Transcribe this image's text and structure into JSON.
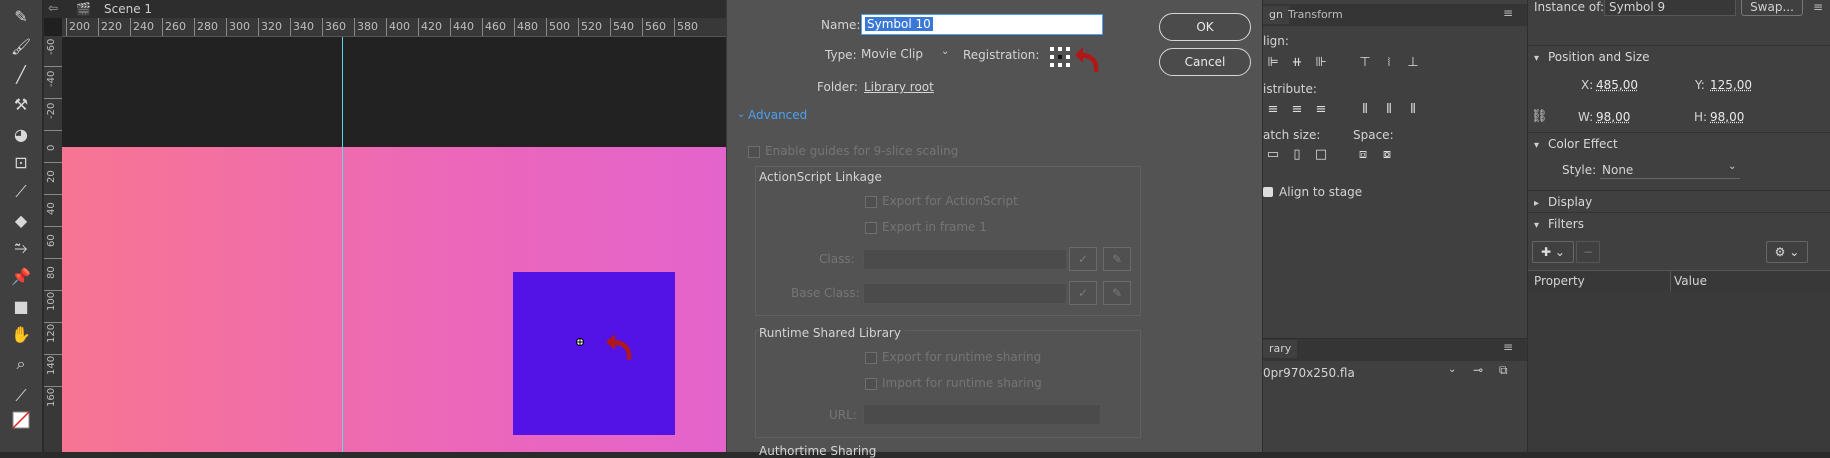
{
  "scene": {
    "label": "Scene 1"
  },
  "ruler": {
    "h_ticks": [
      "200",
      "220",
      "240",
      "260",
      "280",
      "300",
      "320",
      "340",
      "360",
      "380",
      "400",
      "420",
      "440",
      "460",
      "480",
      "500",
      "520",
      "540",
      "560",
      "580"
    ],
    "v_ticks": [
      "-60",
      "-40",
      "-20",
      "0",
      "20",
      "40",
      "60",
      "80",
      "100",
      "120",
      "140",
      "160"
    ]
  },
  "tools": [
    "pencil-icon",
    "paintbrush-icon",
    "brush-icon",
    "bone-icon",
    "paint-bucket-icon",
    "asset-warp-icon",
    "eyedropper-icon",
    "eraser-icon",
    "width-tool-icon",
    "pin-icon",
    "camera-icon",
    "hand-icon",
    "zoom-icon",
    "eyedropper-small-icon",
    "stroke-fill-icon"
  ],
  "dialog": {
    "name_label": "Name:",
    "name_value": "Symbol 10",
    "type_label": "Type:",
    "type_value": "Movie Clip",
    "registration_label": "Registration:",
    "folder_label": "Folder:",
    "folder_value": "Library root",
    "ok": "OK",
    "cancel": "Cancel",
    "advanced": "Advanced",
    "enable_guides": "Enable guides for 9-slice scaling",
    "as_linkage_title": "ActionScript Linkage",
    "export_as": "Export for ActionScript",
    "export_frame1": "Export in frame 1",
    "class_label": "Class:",
    "base_class_label": "Base Class:",
    "rsl_title": "Runtime Shared Library",
    "export_runtime": "Export for runtime sharing",
    "import_runtime": "Import for runtime sharing",
    "url_label": "URL:",
    "authortime_title": "Authortime Sharing"
  },
  "align_panel": {
    "tab_align": "gn",
    "tab_transform": "Transform",
    "align_label": "lign:",
    "distribute_label": "istribute:",
    "match_size_label": "atch size:",
    "space_label": "Space:",
    "align_to_stage": "Align to stage",
    "library_tab": "rary",
    "library_file": "0pr970x250.fla"
  },
  "properties": {
    "instance_of_label": "Instance of:",
    "instance_of_value": "Symbol 9",
    "swap": "Swap...",
    "pos_size_title": "Position and Size",
    "x_label": "X:",
    "x_value": "485,00",
    "y_label": "Y:",
    "y_value": "125,00",
    "w_label": "W:",
    "w_value": "98,00",
    "h_label": "H:",
    "h_value": "98,00",
    "color_effect_title": "Color Effect",
    "style_label": "Style:",
    "style_value": "None",
    "display_title": "Display",
    "filters_title": "Filters",
    "col_property": "Property",
    "col_value": "Value"
  },
  "colors": {
    "stage_pink": "#f77592",
    "stage_magenta": "#e364cc",
    "symbol_blue": "#5313e6",
    "guide_cyan": "#5fd9e8",
    "accent_blue": "#4ba0f0",
    "reg_arrow_red": "#b01818"
  }
}
